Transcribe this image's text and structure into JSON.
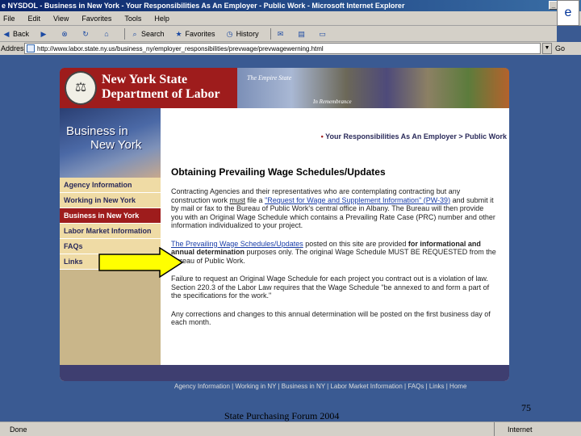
{
  "window": {
    "title": "NYSDOL - Business in New York - Your Responsibilities As An Employer - Public Work - Microsoft Internet Explorer"
  },
  "menu": [
    "File",
    "Edit",
    "View",
    "Favorites",
    "Tools",
    "Help"
  ],
  "toolbar": {
    "back": "Back",
    "search": "Search",
    "favorites": "Favorites",
    "history": "History"
  },
  "address": {
    "label": "Address",
    "url": "http://www.labor.state.ny.us/business_ny/employer_responsibilities/prevwage/prevwagewerning.html",
    "go": "Go"
  },
  "header": {
    "org_line1": "New York State",
    "org_line2": "Department of Labor",
    "banner_tagline": "The Empire State",
    "banner_caption": "In Remembrance"
  },
  "leftnav": {
    "hero_line1": "Business in",
    "hero_line2": "New York",
    "items": [
      {
        "label": "Agency Information",
        "active": false
      },
      {
        "label": "Working in New York",
        "active": false
      },
      {
        "label": "Business in New York",
        "active": true
      },
      {
        "label": "Labor Market Information",
        "active": false
      },
      {
        "label": "FAQs",
        "active": false
      },
      {
        "label": "Links",
        "active": false
      }
    ]
  },
  "breadcrumb": {
    "item1": "Your Responsibilities As An Employer",
    "separator": ">",
    "item2": "Public Work"
  },
  "content": {
    "heading": "Obtaining Prevailing Wage Schedules/Updates",
    "p1_a": "Contracting Agencies and their representatives who are contemplating contracting but any construction work ",
    "p1_must": "must",
    "p1_b": " file a ",
    "p1_link": "\"Request for Wage and Supplement Information\" (PW-39)",
    "p1_c": " and submit it by mail or fax to the Bureau of Public Work's central office in Albany.  The Bureau will then provide you with an Original Wage Schedule which contains a Prevailing Rate Case (PRC) number and other information individualized to your project.",
    "p2_link": "The Prevailing Wage Schedules/Updates",
    "p2_a": " posted on this site are provided ",
    "p2_bold": "for informational and annual determination",
    "p2_b": " purposes only. The original Wage Schedule MUST BE REQUESTED from the Bureau of Public Work.",
    "p3": "Failure to request an Original Wage Schedule for each project you contract out is a violation of law.  Section 220.3 of the Labor Law requires that the Wage Schedule \"be annexed to and form a part of the specifications for the work.\"",
    "p4": "Any corrections and changes to this annual determination will be posted on the first business day of each month."
  },
  "footer_links": "Agency Information | Working in NY | Business in NY | Labor Market Information | FAQs | Links | Home",
  "status": {
    "left": "Done",
    "zone": "Internet"
  },
  "slide": {
    "footer": "State Purchasing Forum 2004",
    "page_number": "75"
  },
  "colors": {
    "dol_red": "#9e1c1c",
    "nav_tan": "#efdba5",
    "navy": "#2a2a5a",
    "arrow_yellow": "#ffff00",
    "slide_bg": "#3a5a92"
  }
}
